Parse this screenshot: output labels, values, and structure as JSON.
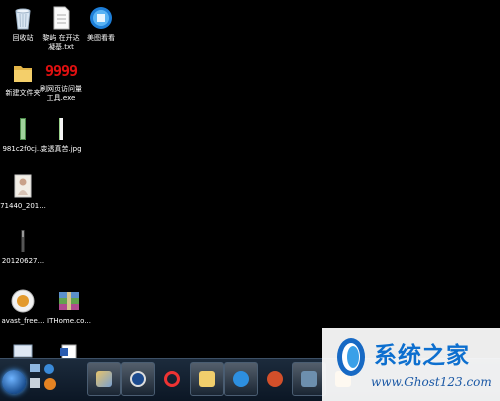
{
  "desktop_icons": {
    "recycle_bin": "回收站",
    "text_file": "黎屿 在开达 凝基.txt",
    "meitu": "美图看看",
    "new_folder": "新建文件夹",
    "counter_tool": "刷网页访问量 工具.exe",
    "image_981": "981c2f0cj...",
    "transparent_jpg": "变透真苦.jpg",
    "image_71440": "71440_201...",
    "image_2012": "20120627...",
    "avast": "avast_free...",
    "ithome": "ITHome.co..."
  },
  "counter_digits": "9999",
  "watermark": {
    "title": "系统之家",
    "url": "www.Ghost123.com"
  },
  "taskbar": {
    "items": [
      "ie",
      "media",
      "quicktime",
      "folder",
      "sogou",
      "qq",
      "network",
      "games",
      "media2"
    ]
  }
}
